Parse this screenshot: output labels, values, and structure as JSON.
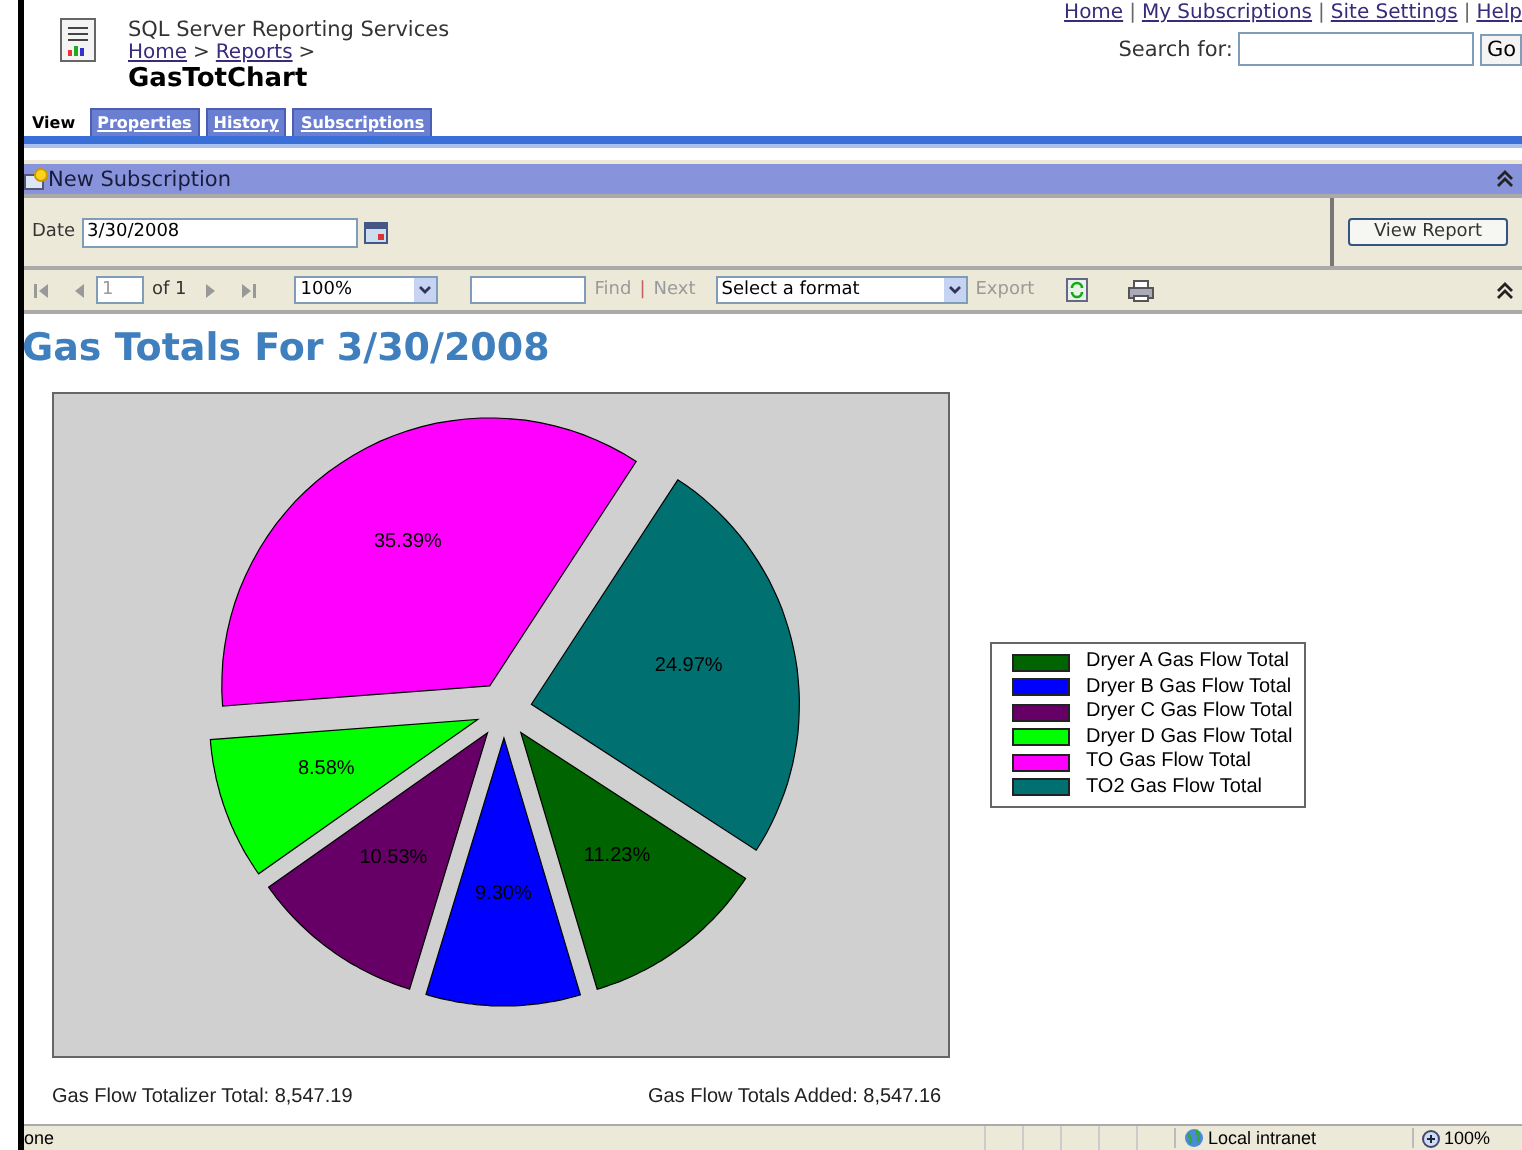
{
  "header": {
    "app_name": "SQL Server Reporting Services",
    "breadcrumbs": [
      {
        "label": "Home",
        "sep": ">"
      },
      {
        "label": "Reports",
        "sep": ">"
      }
    ],
    "title": "GasTotChart",
    "links": [
      "Home",
      "My Subscriptions",
      "Site Settings",
      "Help"
    ],
    "link_separator": "|",
    "search_label": "Search for:",
    "search_button": "Go"
  },
  "tabs": [
    {
      "label": "View",
      "selected": true
    },
    {
      "label": "Properties",
      "selected": false
    },
    {
      "label": "History",
      "selected": false
    },
    {
      "label": "Subscriptions",
      "selected": false
    }
  ],
  "subscription_bar": {
    "label": "New Subscription"
  },
  "parameters": {
    "label": "Date",
    "value": "3/30/2008",
    "button": "View Report"
  },
  "toolbar": {
    "page": "1",
    "of": "of 1",
    "zoom": "100%",
    "find": "Find",
    "sep": "|",
    "next": "Next",
    "format": "Select a format",
    "export": "Export"
  },
  "report": {
    "title": "Gas Totals For 3/30/2008",
    "chart_data": {
      "type": "pie",
      "value_labels": [
        "11.23%",
        "9.30%",
        "10.53%",
        "8.58%",
        "35.39%",
        "24.97%"
      ],
      "categories": [
        "Dryer A Gas Flow Total",
        "Dryer B Gas Flow Total",
        "Dryer C Gas Flow Total",
        "Dryer D Gas Flow Total",
        "TO Gas Flow Total",
        "TO2 Gas Flow Total"
      ],
      "series": [
        {
          "colors": [
            "#006400",
            "#0000ff",
            "#660066",
            "#00ff00",
            "#ff00ff",
            "#007070"
          ],
          "values": [
            11.23,
            9.3,
            10.53,
            8.58,
            35.39,
            24.97
          ]
        }
      ]
    },
    "footer": [
      "Gas Flow Totalizer Total: 8,547.19",
      "Gas Flow Totals Added: 8,547.16"
    ]
  },
  "status_bar": {
    "text": "one",
    "zone": "Local intranet",
    "zoom": "100%"
  }
}
